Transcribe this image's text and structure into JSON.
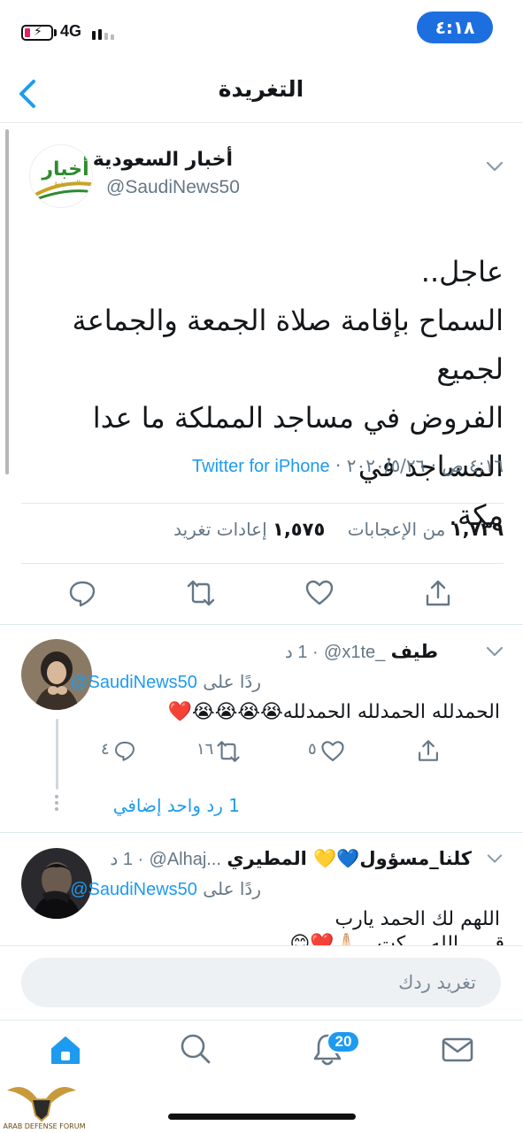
{
  "status_bar": {
    "network": "4G",
    "time": "٤:١٨"
  },
  "header": {
    "title": "التغريدة"
  },
  "tweet": {
    "author_name": "أخبار السعودية",
    "author_handle": "@SaudiNews50",
    "avatar_text": "أخبار",
    "avatar_sub": "السعودية",
    "lines": [
      "عاجل..",
      "السماح بإقامة صلاة الجمعة والجماعة لجميع",
      "الفروض في مساجد المملكة ما عدا المساجد في",
      "مكة."
    ],
    "time": "٤:١٦ ص",
    "date": "٢٠٢٠/٥/٢٦",
    "source": "Twitter for iPhone",
    "retweets_count": "١,٥٧٥",
    "retweets_label": "إعادات تغريد",
    "likes_count": "١,٧٣٩",
    "likes_label": "من الإعجابات"
  },
  "replies": [
    {
      "name": "طيف",
      "handle": "@x1te_",
      "age": "1 د",
      "replying_label": "ردًا على",
      "replying_to": "@SaudiNews50",
      "text": "الحمدلله الحمدلله الحمدلله😭😭😭😭❤️",
      "reply_count": "٤",
      "retweet_count": "١٦",
      "like_count": "٥",
      "more_replies": "1 رد واحد إضافي"
    },
    {
      "name": "كلنا_مسؤول💙💛 المطيري",
      "handle": "@Alhaj...",
      "age": "1 د",
      "replying_label": "ردًا على",
      "replying_to": "@SaudiNews50",
      "text": "اللهم لك الحمد يارب",
      "text2": "قـ ... الله ...كت...🙏🏻❤️😊"
    }
  ],
  "compose": {
    "placeholder": "تغريد ردك"
  },
  "tabbar": {
    "notifications_badge": "20"
  },
  "watermark": {
    "text": "ARAB DEFENSE FORUM"
  },
  "colors": {
    "accent": "#1d9bf0",
    "time_pill": "#1d6fe0",
    "heart": "#e0245e",
    "secondary_text": "#657786"
  }
}
